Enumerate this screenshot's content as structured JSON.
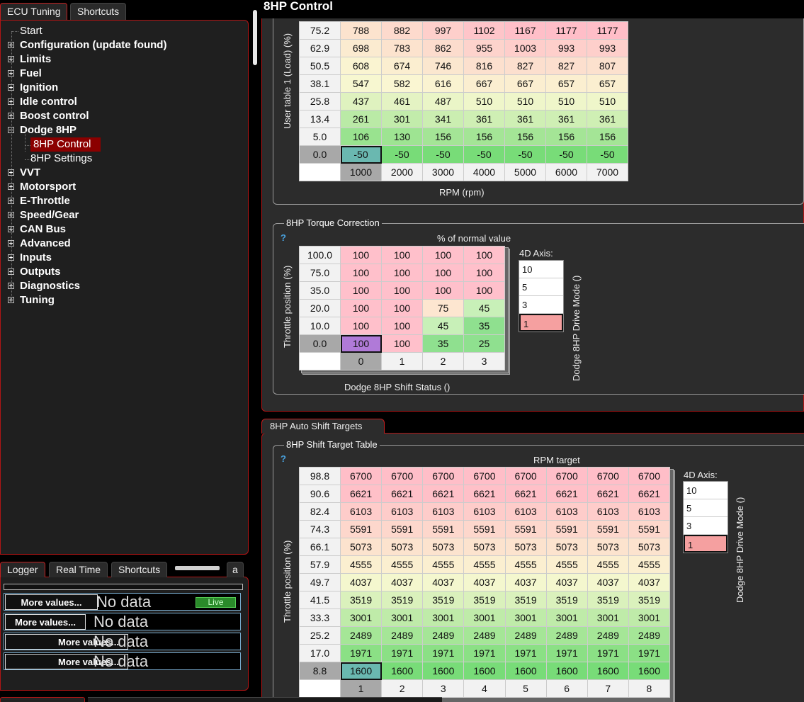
{
  "left_tabs": {
    "ecu_tuning": "ECU Tuning",
    "shortcuts": "Shortcuts"
  },
  "tree": {
    "start": "Start",
    "items": [
      "Configuration (update found)",
      "Limits",
      "Fuel",
      "Ignition",
      "Idle control",
      "Boost control",
      "Dodge 8HP"
    ],
    "children": [
      "8HP Control",
      "8HP Settings"
    ],
    "items_after": [
      "VVT",
      "Motorsport",
      "E-Throttle",
      "Speed/Gear",
      "CAN Bus",
      "Advanced",
      "Inputs",
      "Outputs",
      "Diagnostics",
      "Tuning"
    ]
  },
  "logger_tabs": {
    "logger": "Logger",
    "realtime": "Real Time",
    "shortcuts": "Shortcuts",
    "a": "a"
  },
  "logger_rows": [
    {
      "btn": "More values...",
      "value": "No data",
      "live": "Live"
    },
    {
      "btn": "More values...",
      "value": "No data"
    },
    {
      "btn": "More values...",
      "value": "No data"
    },
    {
      "btn": "More values...",
      "value": "No data"
    }
  ],
  "title": "8HP Control",
  "user_table": {
    "y_label": "User table 1 (Load) (%)",
    "x_label": "RPM (rpm)",
    "rows": [
      {
        "y": "75.2",
        "v": [
          "788",
          "882",
          "997",
          "1102",
          "1167",
          "1177",
          "1177"
        ]
      },
      {
        "y": "62.9",
        "v": [
          "698",
          "783",
          "862",
          "955",
          "1003",
          "993",
          "993"
        ]
      },
      {
        "y": "50.5",
        "v": [
          "608",
          "674",
          "746",
          "816",
          "827",
          "827",
          "807"
        ]
      },
      {
        "y": "38.1",
        "v": [
          "547",
          "582",
          "616",
          "667",
          "667",
          "657",
          "657"
        ]
      },
      {
        "y": "25.8",
        "v": [
          "437",
          "461",
          "487",
          "510",
          "510",
          "510",
          "510"
        ]
      },
      {
        "y": "13.4",
        "v": [
          "261",
          "301",
          "341",
          "361",
          "361",
          "361",
          "361"
        ]
      },
      {
        "y": "5.0",
        "v": [
          "106",
          "130",
          "156",
          "156",
          "156",
          "156",
          "156"
        ]
      },
      {
        "y": "0.0",
        "v": [
          "-50",
          "-50",
          "-50",
          "-50",
          "-50",
          "-50",
          "-50"
        ]
      }
    ],
    "x": [
      "1000",
      "2000",
      "3000",
      "4000",
      "5000",
      "6000",
      "7000"
    ]
  },
  "torque": {
    "group_title": "8HP Torque Correction",
    "help": "?",
    "value_label": "% of normal value",
    "y_label": "Throttle position (%)",
    "x_label": "Dodge 8HP Shift Status ()",
    "d4_title": "4D Axis:",
    "d4_values": [
      "10",
      "5",
      "3",
      "1"
    ],
    "d4_label": "Dodge 8HP Drive Mode ()",
    "rows": [
      {
        "y": "100.0",
        "v": [
          "100",
          "100",
          "100",
          "100"
        ]
      },
      {
        "y": "75.0",
        "v": [
          "100",
          "100",
          "100",
          "100"
        ]
      },
      {
        "y": "35.0",
        "v": [
          "100",
          "100",
          "100",
          "100"
        ]
      },
      {
        "y": "20.0",
        "v": [
          "100",
          "100",
          "75",
          "45"
        ]
      },
      {
        "y": "10.0",
        "v": [
          "100",
          "100",
          "45",
          "35"
        ]
      },
      {
        "y": "0.0",
        "v": [
          "100",
          "100",
          "35",
          "25"
        ]
      }
    ],
    "x": [
      "0",
      "1",
      "2",
      "3"
    ]
  },
  "auto_shift": {
    "frame_tab": "8HP Auto Shift Targets",
    "group_title": "8HP Shift Target Table",
    "help": "?",
    "value_label": "RPM target",
    "y_label": "Throttle position (%)",
    "d4_title": "4D Axis:",
    "d4_values": [
      "10",
      "5",
      "3",
      "1"
    ],
    "d4_label": "Dodge 8HP Drive Mode ()",
    "rows": [
      {
        "y": "98.8",
        "v": "6700"
      },
      {
        "y": "90.6",
        "v": "6621"
      },
      {
        "y": "82.4",
        "v": "6103"
      },
      {
        "y": "74.3",
        "v": "5591"
      },
      {
        "y": "66.1",
        "v": "5073"
      },
      {
        "y": "57.9",
        "v": "4555"
      },
      {
        "y": "49.7",
        "v": "4037"
      },
      {
        "y": "41.5",
        "v": "3519"
      },
      {
        "y": "33.3",
        "v": "3001"
      },
      {
        "y": "25.2",
        "v": "2489"
      },
      {
        "y": "17.0",
        "v": "1971"
      },
      {
        "y": "8.8",
        "v": "1600"
      }
    ],
    "x": [
      "1",
      "2",
      "3",
      "4",
      "5",
      "6",
      "7",
      "8"
    ]
  },
  "colors": {
    "accent": "#b01515",
    "selected_node": "#8b0000",
    "help": "#4aa3e0"
  }
}
